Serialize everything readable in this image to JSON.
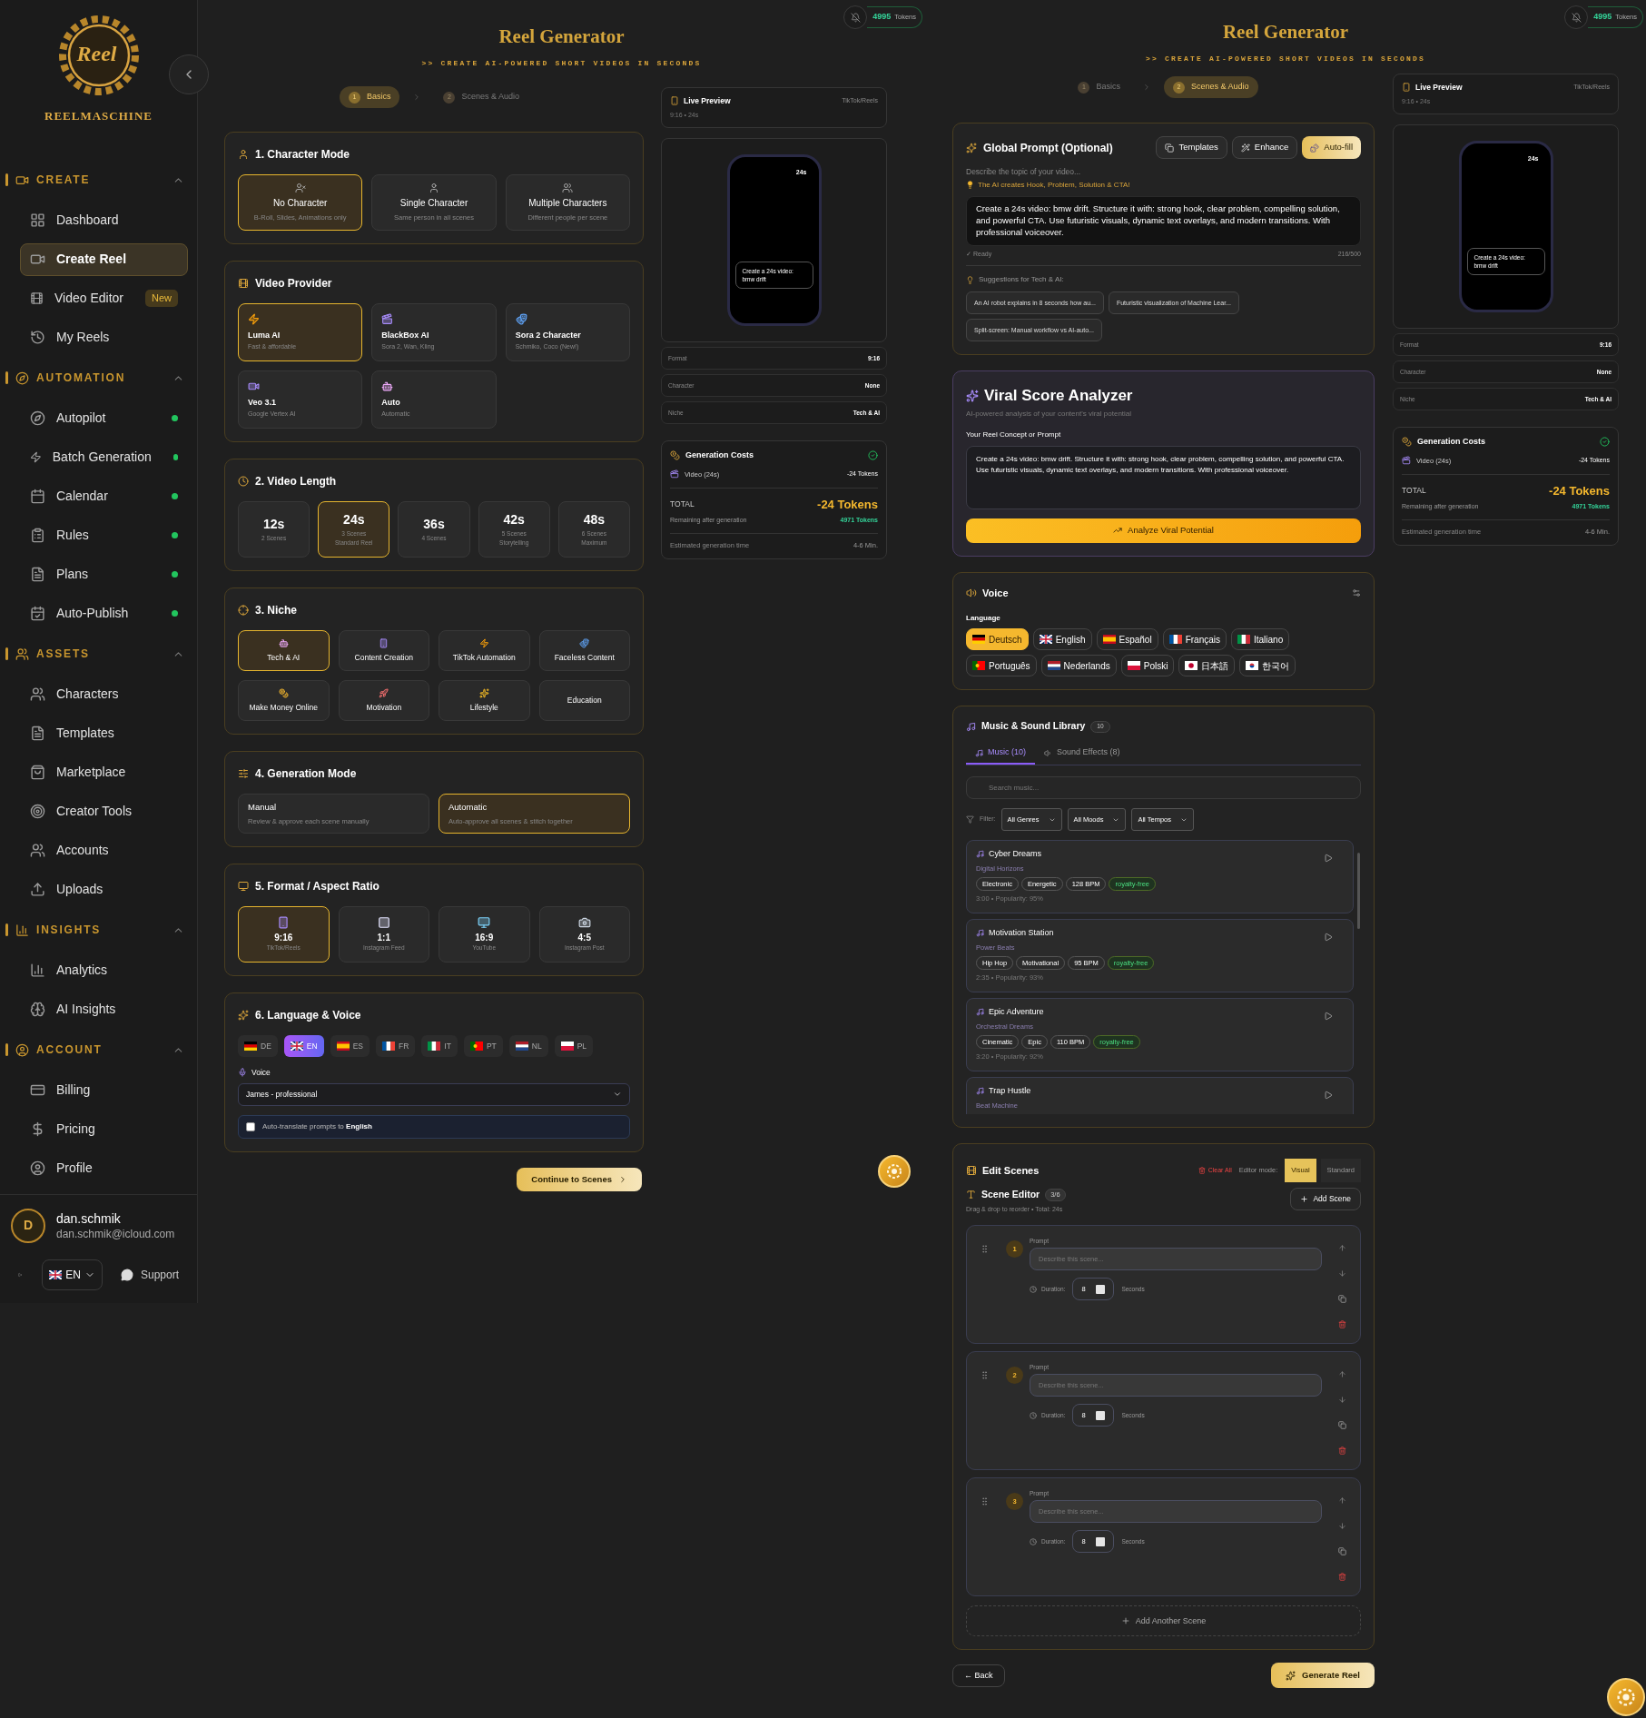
{
  "sidebar": {
    "logo_text": "Reel",
    "brand": "REELMASCHINE",
    "sections": [
      {
        "title": "CREATE",
        "expanded": true,
        "items": [
          {
            "label": "Dashboard",
            "selected": false
          },
          {
            "label": "Create Reel",
            "selected": true
          },
          {
            "label": "Video Editor",
            "selected": false,
            "badge": "New"
          },
          {
            "label": "My Reels",
            "selected": false
          }
        ]
      },
      {
        "title": "AUTOMATION",
        "expanded": true,
        "items": [
          {
            "label": "Autopilot",
            "selected": false,
            "active": true
          },
          {
            "label": "Batch Generation",
            "selected": false,
            "active": true
          },
          {
            "label": "Calendar",
            "selected": false,
            "active": true
          },
          {
            "label": "Rules",
            "selected": false,
            "active": true
          },
          {
            "label": "Plans",
            "selected": false,
            "active": true
          },
          {
            "label": "Auto-Publish",
            "selected": false,
            "active": true
          }
        ]
      },
      {
        "title": "ASSETS",
        "expanded": true,
        "items": [
          {
            "label": "Characters",
            "selected": false
          },
          {
            "label": "Templates",
            "selected": false
          },
          {
            "label": "Marketplace",
            "selected": false
          },
          {
            "label": "Creator Tools",
            "selected": false
          },
          {
            "label": "Accounts",
            "selected": false
          },
          {
            "label": "Uploads",
            "selected": false
          }
        ]
      },
      {
        "title": "INSIGHTS",
        "expanded": true,
        "items": [
          {
            "label": "Analytics",
            "selected": false
          },
          {
            "label": "AI Insights",
            "selected": false
          }
        ]
      },
      {
        "title": "ACCOUNT",
        "expanded": true,
        "items": [
          {
            "label": "Billing",
            "selected": false
          },
          {
            "label": "Pricing",
            "selected": false
          },
          {
            "label": "Profile",
            "selected": false
          }
        ]
      }
    ],
    "user": {
      "initial": "D",
      "name": "dan.schmik",
      "email": "dan.schmik@icloud.com"
    },
    "language": "EN",
    "support": "Support"
  },
  "basics": {
    "tokens": {
      "count": "4995",
      "label": "Tokens"
    },
    "title": "Reel Generator",
    "tagline": ">> CREATE AI-POWERED SHORT VIDEOS IN SECONDS",
    "steps": [
      {
        "number": "1",
        "label": "Basics",
        "selected": true
      },
      {
        "number": "2",
        "label": "Scenes & Audio",
        "selected": false
      }
    ],
    "character_mode": {
      "title": "1. Character Mode",
      "options": [
        {
          "title": "No Character",
          "subtitle": "B-Roll, Slides, Animations only",
          "selected": true
        },
        {
          "title": "Single Character",
          "subtitle": "Same person in all scenes",
          "selected": false
        },
        {
          "title": "Multiple Characters",
          "subtitle": "Different people per scene",
          "selected": false
        }
      ]
    },
    "video_provider": {
      "title": "Video Provider",
      "options": [
        {
          "name": "Luma AI",
          "description": "Fast & affordable",
          "selected": true
        },
        {
          "name": "BlackBox AI",
          "description": "Sora 2, Wan, Kling",
          "selected": false
        },
        {
          "name": "Sora 2 Character",
          "description": "Schmiko, Coco (New!)",
          "selected": false
        },
        {
          "name": "Veo 3.1",
          "description": "Google Vertex AI",
          "selected": false
        },
        {
          "name": "Auto",
          "description": "Automatic",
          "selected": false
        }
      ]
    },
    "video_length": {
      "title": "2. Video Length",
      "options": [
        {
          "value": "12s",
          "scenes": "2 Scenes",
          "selected": false
        },
        {
          "value": "24s",
          "scenes": "3 Scenes",
          "note": "Standard Reel",
          "selected": true
        },
        {
          "value": "36s",
          "scenes": "4 Scenes",
          "selected": false
        },
        {
          "value": "42s",
          "scenes": "5 Scenes",
          "note": "Storytelling",
          "selected": false
        },
        {
          "value": "48s",
          "scenes": "6 Scenes",
          "note": "Maximum",
          "selected": false
        }
      ]
    },
    "niche": {
      "title": "3. Niche",
      "options": [
        {
          "label": "Tech & AI",
          "selected": true
        },
        {
          "label": "Content Creation",
          "selected": false
        },
        {
          "label": "TikTok Automation",
          "selected": false
        },
        {
          "label": "Faceless Content",
          "selected": false
        },
        {
          "label": "Make Money Online",
          "selected": false
        },
        {
          "label": "Motivation",
          "selected": false
        },
        {
          "label": "Lifestyle",
          "selected": false
        },
        {
          "label": "Education",
          "selected": false
        }
      ]
    },
    "generation_mode": {
      "title": "4. Generation Mode",
      "options": [
        {
          "title": "Manual",
          "description": "Review & approve each scene manually",
          "selected": false
        },
        {
          "title": "Automatic",
          "description": "Auto-approve all scenes & stitch together",
          "selected": true
        }
      ]
    },
    "format": {
      "title": "5. Format / Aspect Ratio",
      "options": [
        {
          "ratio": "9:16",
          "label": "TikTok/Reels",
          "selected": true
        },
        {
          "ratio": "1:1",
          "label": "Instagram Feed",
          "selected": false
        },
        {
          "ratio": "16:9",
          "label": "YouTube",
          "selected": false
        },
        {
          "ratio": "4:5",
          "label": "Instagram Post",
          "selected": false
        }
      ]
    },
    "language_voice": {
      "title": "6. Language & Voice",
      "languages": [
        {
          "code": "DE",
          "selected": false
        },
        {
          "code": "EN",
          "selected": true
        },
        {
          "code": "ES",
          "selected": false
        },
        {
          "code": "FR",
          "selected": false
        },
        {
          "code": "IT",
          "selected": false
        },
        {
          "code": "PT",
          "selected": false
        },
        {
          "code": "NL",
          "selected": false
        },
        {
          "code": "PL",
          "selected": false
        }
      ],
      "voice_label": "Voice",
      "voice_value": "James - professional",
      "auto_translate": {
        "text": "Auto-translate prompts to **English**",
        "checked": false
      }
    },
    "continue_button": "Continue to Scenes",
    "preview": {
      "title": "Live Preview",
      "platform": "TikTok/Reels",
      "meta": "9:16 • 24s",
      "phone_duration": "24s",
      "phone_caption": "Create a 24s video: bmw drift",
      "rows": [
        {
          "label": "Format",
          "value": "9:16"
        },
        {
          "label": "Character",
          "value": "None"
        },
        {
          "label": "Niche",
          "value": "Tech & AI"
        }
      ],
      "costs": {
        "title": "Generation Costs",
        "item_label": "Video (24s)",
        "item_value": "-24 Tokens",
        "total_label": "TOTAL",
        "total_value": "-24 Tokens",
        "remaining_label": "Remaining after generation",
        "remaining_value": "4971 Tokens",
        "time_label": "Estimated generation time",
        "time_value": "4-6 Min."
      }
    }
  },
  "scenes_audio": {
    "tokens": {
      "count": "4995",
      "label": "Tokens"
    },
    "title": "Reel Generator",
    "tagline": ">> CREATE AI-POWERED SHORT VIDEOS IN SECONDS",
    "steps": [
      {
        "number": "1",
        "label": "Basics",
        "selected": false
      },
      {
        "number": "2",
        "label": "Scenes & Audio",
        "selected": true
      }
    ],
    "global_prompt": {
      "title": "Global Prompt (Optional)",
      "buttons": [
        {
          "label": "Templates",
          "kind": "secondary"
        },
        {
          "label": "Enhance",
          "kind": "secondary"
        },
        {
          "label": "Auto-fill",
          "kind": "primary"
        }
      ],
      "hint": "Describe the topic of your video...",
      "tip": "The AI creates Hook, Problem, Solution & CTA!",
      "text": "Create a 24s video: bmw drift. Structure it with: strong hook, clear problem, compelling solution, and powerful CTA. Use futuristic visuals, dynamic text overlays, and modern transitions. With professional voiceover.",
      "status": "✓ Ready",
      "count": "216/500",
      "suggestions_title": "Suggestions for Tech & AI:",
      "suggestions": [
        "An AI robot explains in 8 seconds how au...",
        "Futuristic visualization of Machine Lear...",
        "Split-screen: Manual workflow vs AI-auto..."
      ]
    },
    "viral": {
      "title": "Viral Score Analyzer",
      "subtitle": "AI-powered analysis of your content's viral potential",
      "label": "Your Reel Concept or Prompt",
      "text": "Create a 24s video: bmw drift. Structure it with: strong hook, clear problem, compelling solution, and powerful CTA. Use futuristic visuals, dynamic text overlays, and modern transitions. With professional voiceover.",
      "button": "Analyze Viral Potential"
    },
    "voice": {
      "title": "Voice",
      "language_label": "Language",
      "languages": [
        {
          "label": "Deutsch",
          "selected": true
        },
        {
          "label": "English",
          "selected": false
        },
        {
          "label": "Español",
          "selected": false
        },
        {
          "label": "Français",
          "selected": false
        },
        {
          "label": "Italiano",
          "selected": false
        },
        {
          "label": "Português",
          "selected": false
        },
        {
          "label": "Nederlands",
          "selected": false
        },
        {
          "label": "Polski",
          "selected": false
        },
        {
          "label": "日本語",
          "selected": false
        },
        {
          "label": "한국어",
          "selected": false
        }
      ]
    },
    "music": {
      "title": "Music & Sound Library",
      "count": "10",
      "tabs": [
        {
          "label": "Music (10)",
          "selected": true
        },
        {
          "label": "Sound Effects (8)",
          "selected": false
        }
      ],
      "search_placeholder": "Search music...",
      "filter_label": "Filter:",
      "filters": [
        "All Genres",
        "All Moods",
        "All Tempos"
      ],
      "tracks": [
        {
          "title": "Cyber Dreams",
          "artist": "Digital Horizons",
          "tags": [
            "Electronic",
            "Energetic",
            "128 BPM"
          ],
          "license": "royalty-free",
          "meta": "3:00 • Popularity: 95%"
        },
        {
          "title": "Motivation Station",
          "artist": "Power Beats",
          "tags": [
            "Hip Hop",
            "Motivational",
            "95 BPM"
          ],
          "license": "royalty-free",
          "meta": "2:35 • Popularity: 93%"
        },
        {
          "title": "Epic Adventure",
          "artist": "Orchestral Dreams",
          "tags": [
            "Cinematic",
            "Epic",
            "110 BPM"
          ],
          "license": "royalty-free",
          "meta": "3:20 • Popularity: 92%"
        },
        {
          "title": "Trap Hustle",
          "artist": "Beat Machine"
        }
      ]
    },
    "scenes": {
      "title": "Edit Scenes",
      "clear_all": "Clear All",
      "mode_label": "Editor mode:",
      "modes": [
        {
          "label": "Visual",
          "selected": true
        },
        {
          "label": "Standard",
          "selected": false
        }
      ],
      "editor_title": "Scene Editor",
      "editor_count": "3/6",
      "editor_hint": "Drag & drop to reorder • Total: 24s",
      "add_scene": "Add Scene",
      "items": [
        {
          "number": "1",
          "prompt_label": "Prompt",
          "placeholder": "Describe this scene...",
          "duration_label": "Duration:",
          "duration": "8",
          "unit": "Seconds"
        },
        {
          "number": "2",
          "prompt_label": "Prompt",
          "placeholder": "Describe this scene...",
          "duration_label": "Duration:",
          "duration": "8",
          "unit": "Seconds"
        },
        {
          "number": "3",
          "prompt_label": "Prompt",
          "placeholder": "Describe this scene...",
          "duration_label": "Duration:",
          "duration": "8",
          "unit": "Seconds"
        }
      ],
      "add_another": "Add Another Scene"
    },
    "back_button": "← Back",
    "generate_button": "Generate Reel",
    "preview": {
      "title": "Live Preview",
      "platform": "TikTok/Reels",
      "meta": "9:16 • 24s",
      "phone_duration": "24s",
      "phone_caption": "Create a 24s video: bmw drift",
      "rows": [
        {
          "label": "Format",
          "value": "9:16"
        },
        {
          "label": "Character",
          "value": "None"
        },
        {
          "label": "Niche",
          "value": "Tech & AI"
        }
      ],
      "costs": {
        "title": "Generation Costs",
        "item_label": "Video (24s)",
        "item_value": "-24 Tokens",
        "total_label": "TOTAL",
        "total_value": "-24 Tokens",
        "remaining_label": "Remaining after generation",
        "remaining_value": "4971 Tokens",
        "time_label": "Estimated generation time",
        "time_value": "4-6 Min."
      }
    }
  }
}
